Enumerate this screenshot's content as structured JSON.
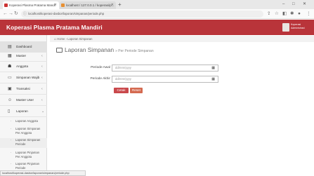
{
  "browser": {
    "tabs": [
      {
        "label": "Koperasi Plasma Pratama Mandi",
        "active": true
      },
      {
        "label": "localhost / 127.0.0.1 / koperasi/p...",
        "active": false
      }
    ],
    "new_tab": "+",
    "window_controls": [
      "–",
      "□",
      "✕"
    ],
    "url": "localhost/koperasi-dasbor/laporan/simpanan/periode.php",
    "toolbar_icons": [
      "share-icon",
      "star-icon",
      "extension-icon",
      "puzzle-icon",
      "profile-icon",
      "menu-icon"
    ]
  },
  "app": {
    "title": "Koperasi Plasma Pratama Mandiri",
    "user": {
      "name": "Koperasi",
      "role": "Administrasi"
    },
    "accent_color": "#b9343a"
  },
  "sidebar": {
    "items": [
      {
        "label": "Dashboard",
        "icon": "dashboard-icon"
      },
      {
        "label": "Master",
        "icon": "database-icon",
        "chevron": "‹"
      },
      {
        "label": "Anggota",
        "icon": "users-icon",
        "chevron": "‹"
      },
      {
        "label": "Simpanan Wajib",
        "icon": "wallet-icon",
        "chevron": "‹"
      },
      {
        "label": "Transaksi",
        "icon": "exchange-icon",
        "chevron": "‹"
      },
      {
        "label": "Master User",
        "icon": "user-icon",
        "chevron": "‹"
      },
      {
        "label": "Laporan",
        "icon": "file-icon",
        "chevron": "⌄"
      }
    ],
    "subitems": [
      "Laporan Anggota",
      "Laporan Simpanan Per Anggota",
      "Laporan Simpanan Periode",
      "Laporan Pinjaman Per Anggota",
      "Laporan Pinjaman Periode"
    ]
  },
  "breadcrumb": {
    "items": [
      "Home",
      "Laporan Simpanan"
    ],
    "separator": "›"
  },
  "page": {
    "title": "Laporan Simpanan",
    "subtitle": "» Per Periode Simpanan"
  },
  "form": {
    "start_label": "Periode Awal",
    "start_value": "dd/mm/yyyy",
    "end_label": "Periode Akhir",
    "end_value": "dd/mm/yyyy",
    "print_button": "Cetak",
    "reset_button": "Reset"
  },
  "statusbar": {
    "text": "localhost/koperasi-dasbor/laporan/simpanan/periode.php"
  }
}
